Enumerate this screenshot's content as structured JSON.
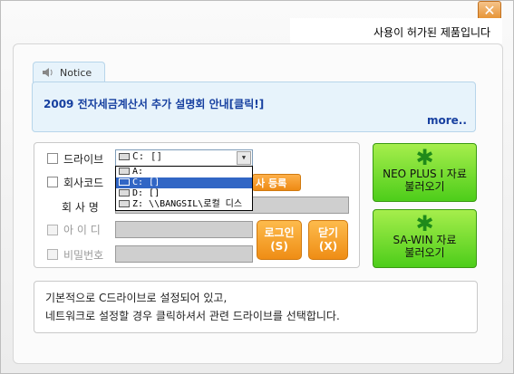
{
  "window": {
    "close_label": "✕",
    "license_text": "사용이 허가된 제품입니다"
  },
  "notice": {
    "tab_label": "Notice",
    "link_text": "2009 전자세금계산서 추가 설명회 안내[클릭!]",
    "more_label": "more.."
  },
  "form": {
    "drive_label": "드라이브",
    "drive_select_value": "C: []",
    "drive_options": [
      "A:",
      "C: []",
      "D: []",
      "Z: \\\\BANGSIL\\로컬 디스"
    ],
    "company_code_label": "회사코드",
    "register_label": "사 등록",
    "company_name_label": "회 사 명",
    "id_label": "아 이 디",
    "password_label": "비밀번호",
    "login_label_1": "로그인",
    "login_label_2": "(S)",
    "close_label_1": "닫기",
    "close_label_2": "(X)"
  },
  "side_buttons": [
    {
      "line1": "NEO PLUS I 자료",
      "line2": "불러오기"
    },
    {
      "line1": "SA-WIN 자료",
      "line2": "불러오기"
    }
  ],
  "info": {
    "line1": "기본적으로 C드라이브로 설정되어 있고,",
    "line2": "네트워크로 설정할 경우 클릭하셔서 관련 드라이브를 선택합니다."
  },
  "colors": {
    "orange": "#ef8d15",
    "green": "#4dcd1a",
    "notice_bg": "#e7f3fb",
    "link": "#1740a0",
    "selection": "#3166c5"
  }
}
